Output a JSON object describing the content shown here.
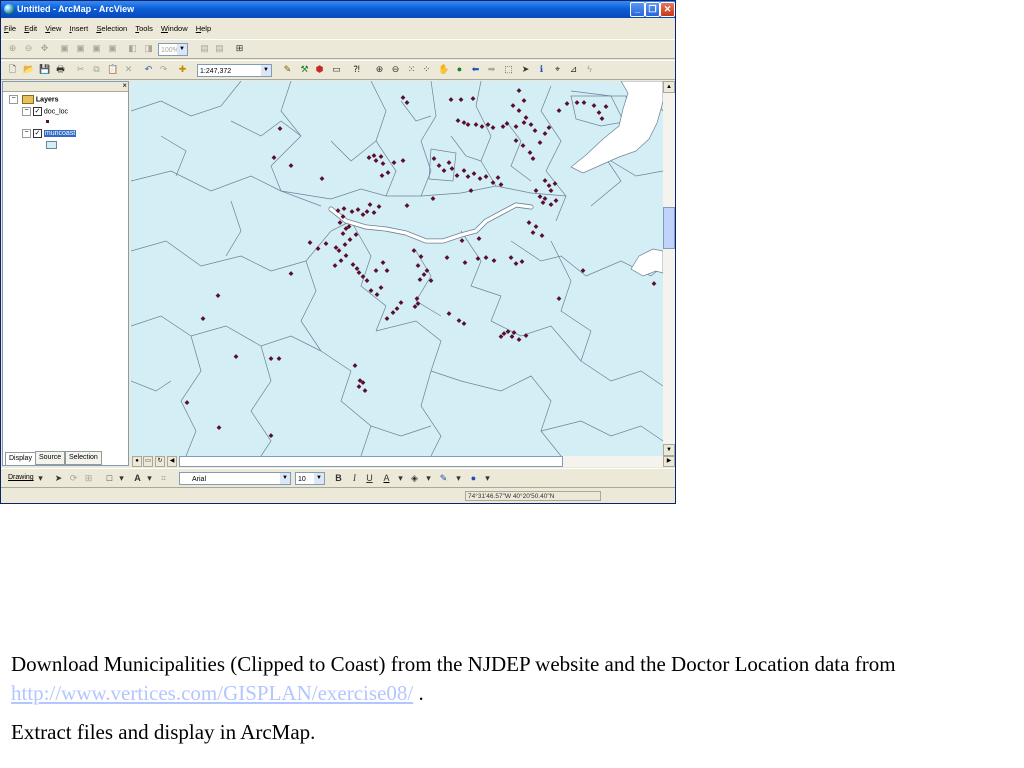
{
  "window": {
    "title": "Untitled - ArcMap - ArcView"
  },
  "menu": [
    "File",
    "Edit",
    "View",
    "Insert",
    "Selection",
    "Tools",
    "Window",
    "Help"
  ],
  "toolbar": {
    "layout_zoom": "100%",
    "scale": "1:247,372"
  },
  "toc": {
    "root_label": "Layers",
    "layers": [
      {
        "name": "doc_loc",
        "checked": true,
        "symbol": "point"
      },
      {
        "name": "muncoast",
        "checked": true,
        "symbol": "polygon",
        "selected": true
      }
    ],
    "tabs": [
      "Display",
      "Source",
      "Selection"
    ]
  },
  "map": {
    "fill_color": "#d3eef5",
    "boundary_color": "#6e8296",
    "point_color": "#5a0f2c",
    "river_color": "#ffffff"
  },
  "drawing_toolbar": {
    "label": "Drawing",
    "font_name": "Arial",
    "font_size": "10"
  },
  "status": {
    "coordinates": "74°31'46.57\"W  40°20'50.40\"N"
  },
  "caption": {
    "p1_before": "Download Municipalities (Clipped to Coast) from the NJDEP website and the Doctor Location data from ",
    "p1_link": "http://www.vertices.com/GISPLAN/exercise08/",
    "p1_after": " .",
    "p2": "Extract files and display in ArcMap."
  }
}
